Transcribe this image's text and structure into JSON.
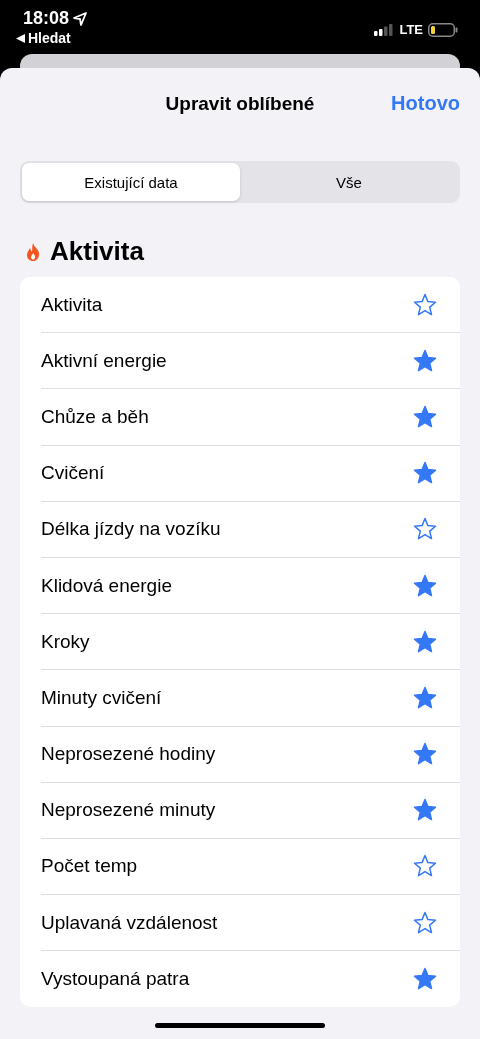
{
  "status_bar": {
    "time": "18:08",
    "back_label": "Hledat",
    "network": "LTE"
  },
  "header": {
    "title": "Upravit oblíbené",
    "done": "Hotovo"
  },
  "tabs": [
    {
      "label": "Existující data",
      "selected": true
    },
    {
      "label": "Vše",
      "selected": false
    }
  ],
  "section": {
    "title": "Aktivita"
  },
  "items": [
    {
      "label": "Aktivita",
      "favorite": false
    },
    {
      "label": "Aktivní energie",
      "favorite": true
    },
    {
      "label": "Chůze a běh",
      "favorite": true
    },
    {
      "label": "Cvičení",
      "favorite": true
    },
    {
      "label": "Délka jízdy na vozíku",
      "favorite": false
    },
    {
      "label": "Klidová energie",
      "favorite": true
    },
    {
      "label": "Kroky",
      "favorite": true
    },
    {
      "label": "Minuty cvičení",
      "favorite": true
    },
    {
      "label": "Neprosezené hodiny",
      "favorite": true
    },
    {
      "label": "Neprosezené minuty",
      "favorite": true
    },
    {
      "label": "Počet temp",
      "favorite": false
    },
    {
      "label": "Uplavaná vzdálenost",
      "favorite": false
    },
    {
      "label": "Vystoupaná patra",
      "favorite": true
    }
  ]
}
